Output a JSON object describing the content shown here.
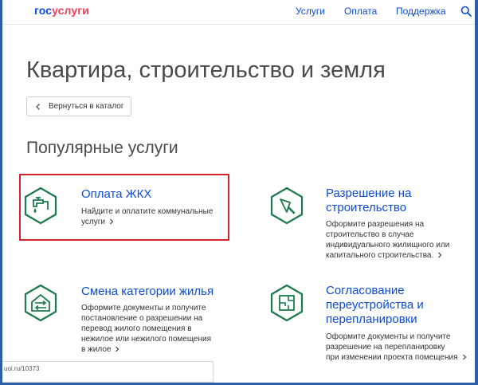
{
  "header": {
    "logo_part1": "гос",
    "logo_part2": "услуги",
    "nav": [
      {
        "label": "Услуги"
      },
      {
        "label": "Оплата"
      },
      {
        "label": "Поддержка"
      }
    ]
  },
  "page": {
    "title": "Квартира, строительство и земля",
    "back_label": "Вернуться в каталог",
    "section_title": "Популярные услуги"
  },
  "services": [
    {
      "title": "Оплата ЖКХ",
      "desc_lines": [
        "Найдите и оплатите коммунальные",
        "услуги"
      ],
      "icon": "faucet-icon"
    },
    {
      "title_lines": [
        "Разрешение на",
        "строительство"
      ],
      "desc_lines": [
        "Оформите разрешения на",
        "строительство в случае",
        "индивидуального жилищного или",
        "капитального строительства."
      ],
      "icon": "trowel-icon"
    },
    {
      "title": "Смена категории жилья",
      "desc_lines": [
        "Оформите документы и получите",
        "постановление о разрешении на",
        "перевод жилого помещения в",
        "нежилое или нежилого помещения",
        "в жилое"
      ],
      "icon": "house-exchange-icon"
    },
    {
      "title_lines": [
        "Согласование",
        "переустройства и",
        "перепланировки"
      ],
      "desc_lines": [
        "Оформите документы и получите",
        "разрешение на перепланировку",
        "при изменении проекта помещения"
      ],
      "icon": "floor-plan-icon"
    }
  ],
  "status_bar": {
    "url": "uoi.ru/10373"
  },
  "colors": {
    "link": "#0d4cd3",
    "logo_red": "#ee3f58",
    "icon_green": "#1d7a4c",
    "highlight": "#d2262f",
    "outer": "#2b5ea6"
  }
}
